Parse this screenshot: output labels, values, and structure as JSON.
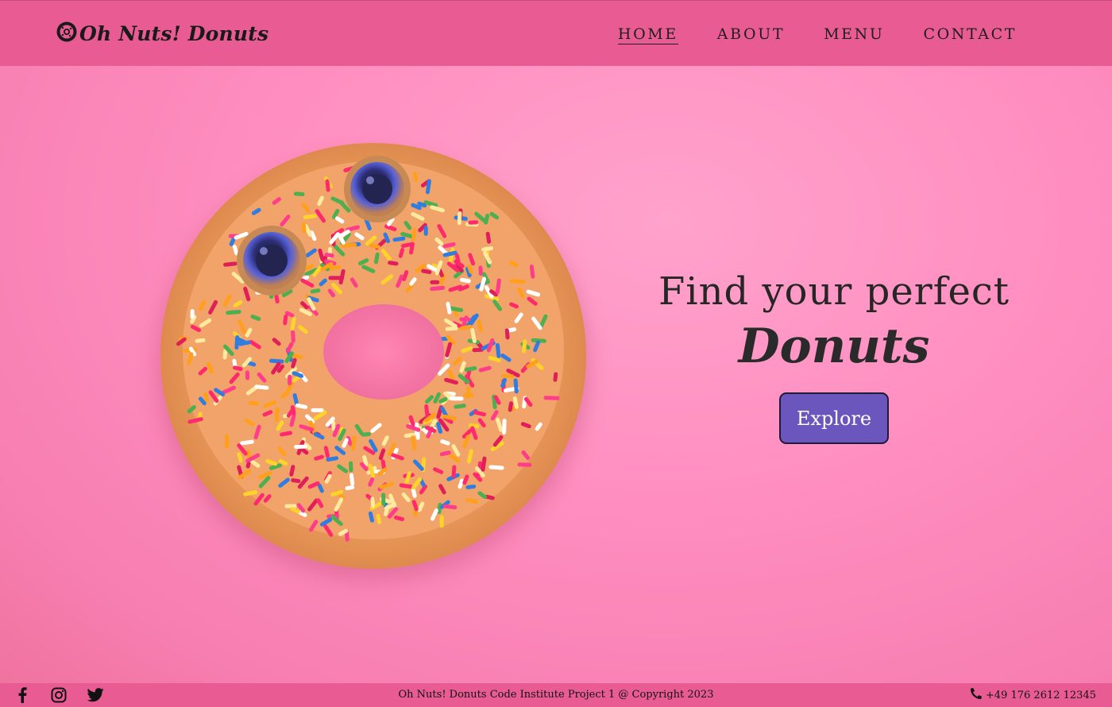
{
  "header": {
    "brand": "Oh Nuts! Donuts",
    "nav": [
      {
        "label": "HOME"
      },
      {
        "label": "ABOUT"
      },
      {
        "label": "MENU"
      },
      {
        "label": "CONTACT"
      }
    ]
  },
  "hero": {
    "headline": "Find your perfect",
    "headline_script": "Donuts",
    "button": "Explore"
  },
  "footer": {
    "social": [
      "facebook-icon",
      "instagram-icon",
      "twitter-icon"
    ],
    "copyright": "Oh Nuts! Donuts Code Institute Project 1 @ Copyright 2023",
    "phone": "+49 176 2612 12345"
  },
  "colors": {
    "header_bg": "#e85c93",
    "hero_bg": "#ff8fc0",
    "button_bg": "#6a56bd"
  }
}
